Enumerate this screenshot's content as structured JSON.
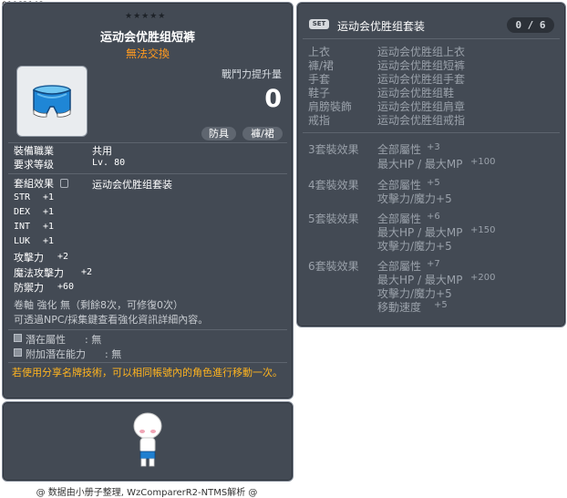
{
  "item_id": "01062148",
  "item": {
    "stars": "★★★★★",
    "name": "运动会优胜组短裤",
    "trade": "無法交換",
    "attack_increase_label": "戰鬥力提升量",
    "attack_increase_value": "0",
    "tags": [
      "防具",
      "褲/裙"
    ],
    "job_label": "裝備職業",
    "job_value": "共用",
    "level_label": "要求等级",
    "level_value": "Lv. 80",
    "set_label": "套組效果",
    "set_value": "运动会优胜组套装",
    "stats": [
      {
        "name": "STR",
        "value": "+1"
      },
      {
        "name": "DEX",
        "value": "+1"
      },
      {
        "name": "INT",
        "value": "+1"
      },
      {
        "name": "LUK",
        "value": "+1"
      },
      {
        "name": "攻擊力",
        "value": "+2"
      },
      {
        "name": "魔法攻擊力",
        "value": "+2"
      },
      {
        "name": "防禦力",
        "value": "+60"
      }
    ],
    "scroll_text": "卷軸 強化 無（剩餘8次，可修復0次）",
    "star_hint": "可透過NPC/採集鍵查看強化資訊詳細內容。",
    "potential_label": "潛在屬性",
    "potential_value": ": 無",
    "add_potential_label": "附加潛在能力",
    "add_potential_value": ": 無",
    "notice": "若使用分享名牌技術，可以相同帳號內的角色進行移動一次。"
  },
  "set_panel": {
    "badge": "SET",
    "title": "运动会优胜组套装",
    "count": "0 / 6",
    "parts": [
      {
        "slot": "上衣",
        "name": "运动会优胜组上衣"
      },
      {
        "slot": "褲/裙",
        "name": "运动会优胜组短裤"
      },
      {
        "slot": "手套",
        "name": "运动会优胜组手套"
      },
      {
        "slot": "鞋子",
        "name": "运动会优胜组鞋"
      },
      {
        "slot": "肩膀裝飾",
        "name": "运动会优胜组肩章"
      },
      {
        "slot": "戒指",
        "name": "运动会优胜组戒指"
      }
    ],
    "effects": [
      {
        "label": "3套裝效果",
        "lines": [
          {
            "text": "全部屬性",
            "value": "+3"
          },
          {
            "text": "最大HP / 最大MP",
            "value": "+100"
          }
        ]
      },
      {
        "label": "4套裝效果",
        "lines": [
          {
            "text": "全部屬性",
            "value": "+5"
          },
          {
            "text": "攻擊力/魔力+5",
            "value": ""
          }
        ]
      },
      {
        "label": "5套裝效果",
        "lines": [
          {
            "text": "全部屬性",
            "value": "+6"
          },
          {
            "text": "最大HP / 最大MP",
            "value": "+150"
          },
          {
            "text": "攻擊力/魔力+5",
            "value": ""
          }
        ]
      },
      {
        "label": "6套裝效果",
        "lines": [
          {
            "text": "全部屬性",
            "value": "+7"
          },
          {
            "text": "最大HP / 最大MP",
            "value": "+200"
          },
          {
            "text": "攻擊力/魔力+5",
            "value": ""
          },
          {
            "text": "移動速度",
            "value": "+5"
          }
        ]
      }
    ]
  },
  "footer": "@ 数据由小册子整理, WzComparerR2-NTMS解析 @"
}
